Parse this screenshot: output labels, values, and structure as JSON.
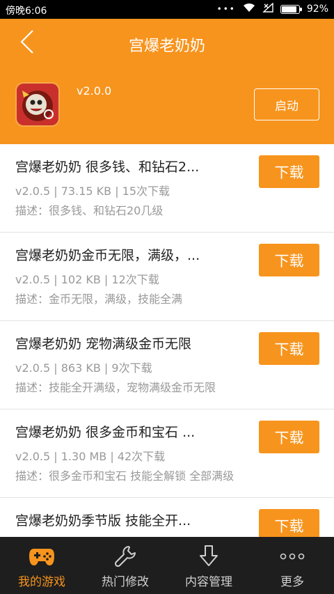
{
  "status_bar": {
    "time": "傍晚6:06",
    "battery": "92%",
    "battery_level": 0.92
  },
  "header": {
    "title": "宫爆老奶奶",
    "version": "v2.0.0",
    "launch_label": "启动"
  },
  "items": [
    {
      "name": "宫爆老奶奶  很多钱、和钻石2...",
      "meta": "v2.0.5 | 73.15 KB | 15次下载",
      "desc": "描述：很多钱、和钻石20几级",
      "download_label": "下载"
    },
    {
      "name": "宫爆老奶奶金币无限，满级，...",
      "meta": "v2.0.5 | 102 KB | 12次下载",
      "desc": "描述：金币无限，满级，技能全满",
      "download_label": "下载"
    },
    {
      "name": "宫爆老奶奶  宠物满级金币无限",
      "meta": "v2.0.5 | 863 KB | 9次下载",
      "desc": "描述：技能全开满级，宠物满级金币无限",
      "download_label": "下载"
    },
    {
      "name": "宫爆老奶奶    很多金币和宝石 ...",
      "meta": "v2.0.5 | 1.30 MB | 42次下载",
      "desc": "描述：很多金币和宝石  技能全解锁  全部满级",
      "download_label": "下载"
    },
    {
      "name": "宫爆老奶奶季节版    技能全开...",
      "meta": "",
      "desc": "",
      "download_label": "下载"
    }
  ],
  "tabs": [
    {
      "label": "我的游戏",
      "icon": "gamepad-icon",
      "active": true
    },
    {
      "label": "热门修改",
      "icon": "wrench-icon",
      "active": false
    },
    {
      "label": "内容管理",
      "icon": "download-arrow-icon",
      "active": false
    },
    {
      "label": "更多",
      "icon": "more-dots-icon",
      "active": false
    }
  ],
  "colors": {
    "accent": "#f7941d",
    "tabbar_bg": "#1e1e1e",
    "text_muted": "#999999"
  }
}
